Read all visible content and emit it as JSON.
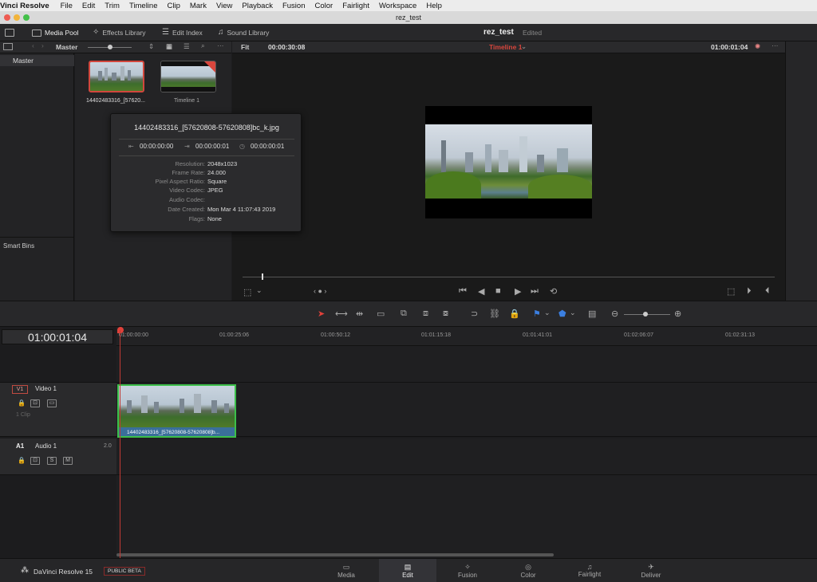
{
  "menubar": {
    "app": "Vinci Resolve",
    "items": [
      "File",
      "Edit",
      "Trim",
      "Timeline",
      "Clip",
      "Mark",
      "View",
      "Playback",
      "Fusion",
      "Color",
      "Fairlight",
      "Workspace",
      "Help"
    ]
  },
  "window_title": "rez_test",
  "toolbar": {
    "media_pool": "Media Pool",
    "effects_library": "Effects Library",
    "edit_index": "Edit Index",
    "sound_library": "Sound Library",
    "project_name": "rez_test",
    "status": "Edited"
  },
  "media_header": {
    "bin": "Master",
    "fit": "Fit",
    "source_tc": "00:00:30:08",
    "timeline_name": "Timeline 1",
    "record_tc": "01:00:01:04"
  },
  "bins": {
    "master": "Master",
    "smart_bins": "Smart Bins"
  },
  "clips": [
    {
      "name": "14402483316_[57620...",
      "label": "14402483316_[57620..."
    },
    {
      "name": "Timeline 1"
    }
  ],
  "popup": {
    "title": "14402483316_[57620808-57620808]bc_k.jpg",
    "tc_in": "00:00:00:00",
    "tc_out": "00:00:00:01",
    "duration": "00:00:00:01",
    "props": [
      {
        "k": "Resolution:",
        "v": "2048x1023"
      },
      {
        "k": "Frame Rate:",
        "v": "24.000"
      },
      {
        "k": "Pixel Aspect Ratio:",
        "v": "Square"
      },
      {
        "k": "Video Codec:",
        "v": "JPEG"
      },
      {
        "k": "Audio Codec:",
        "v": ""
      },
      {
        "k": "Date Created:",
        "v": "Mon Mar  4 11:07:43 2019"
      },
      {
        "k": "Flags:",
        "v": "None"
      }
    ]
  },
  "timeline": {
    "timecode": "01:00:01:04",
    "ruler": [
      "01:00:00:00",
      "01:00:25:06",
      "01:00:50:12",
      "01:01:15:18",
      "01:01:41:01",
      "01:02:06:07",
      "01:02:31:13"
    ],
    "video_track": {
      "id": "V1",
      "name": "Video 1",
      "clip_count": "1 Clip",
      "clip_name": "14402483316_[57620808-57620808]b..."
    },
    "audio_track": {
      "id": "A1",
      "name": "Audio 1",
      "channels": "2.0",
      "solo": "S",
      "mute": "M"
    }
  },
  "footer": {
    "app": "DaVinci Resolve 15",
    "badge": "PUBLIC BETA",
    "pages": [
      "Media",
      "Edit",
      "Fusion",
      "Color",
      "Fairlight",
      "Deliver"
    ],
    "active": "Edit"
  },
  "colors": {
    "accent_red": "#e0413a",
    "selected_clip_border": "#d2473d",
    "clip_green": "#3cbf4a",
    "timeline_name": "#d9463d"
  }
}
